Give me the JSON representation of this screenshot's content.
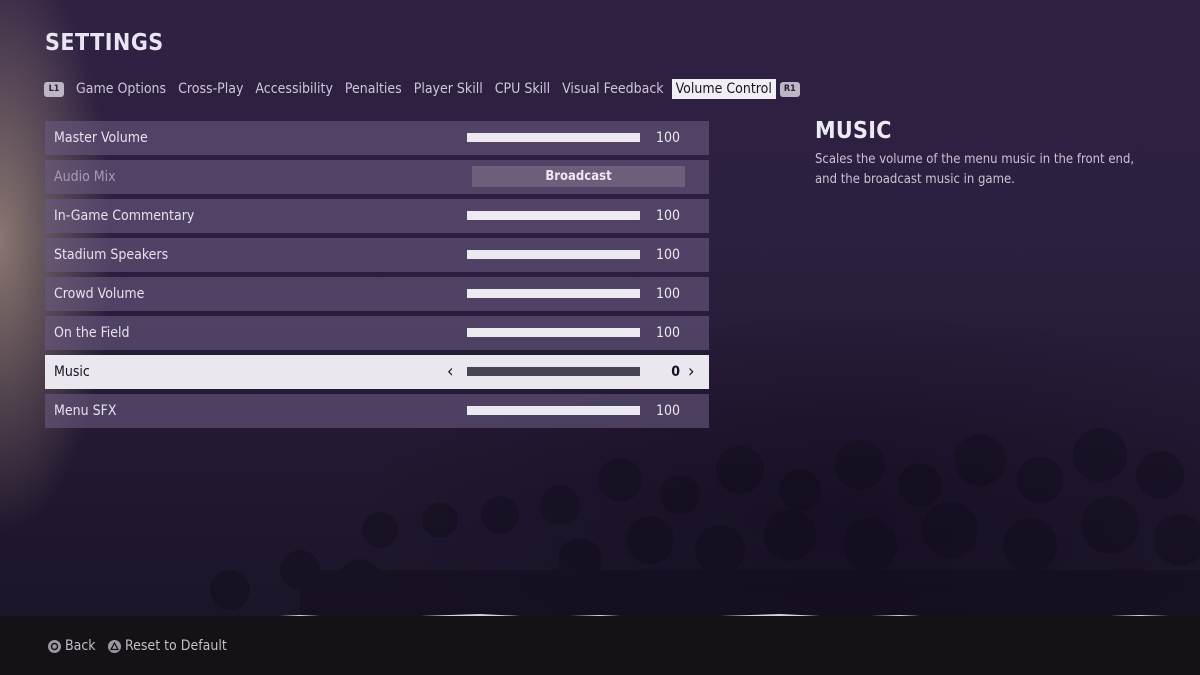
{
  "header": {
    "title": "SETTINGS"
  },
  "tabs": {
    "left_bumper": "L1",
    "right_bumper": "R1",
    "items": [
      {
        "label": "Game Options"
      },
      {
        "label": "Cross-Play"
      },
      {
        "label": "Accessibility"
      },
      {
        "label": "Penalties"
      },
      {
        "label": "Player Skill"
      },
      {
        "label": "CPU Skill"
      },
      {
        "label": "Visual Feedback"
      },
      {
        "label": "Volume Control",
        "active": true
      }
    ]
  },
  "settings": [
    {
      "label": "Master Volume",
      "type": "slider",
      "value": "100",
      "level": 1.0
    },
    {
      "label": "Audio Mix",
      "type": "select",
      "value": "Broadcast",
      "disabled": true
    },
    {
      "label": "In-Game Commentary",
      "type": "slider",
      "value": "100",
      "level": 1.0
    },
    {
      "label": "Stadium Speakers",
      "type": "slider",
      "value": "100",
      "level": 1.0
    },
    {
      "label": "Crowd Volume",
      "type": "slider",
      "value": "100",
      "level": 1.0
    },
    {
      "label": "On the Field",
      "type": "slider",
      "value": "100",
      "level": 1.0
    },
    {
      "label": "Music",
      "type": "slider",
      "value": "0",
      "level": 0.0,
      "selected": true
    },
    {
      "label": "Menu SFX",
      "type": "slider",
      "value": "100",
      "level": 1.0
    }
  ],
  "description": {
    "title": "MUSIC",
    "line1": "Scales the volume of the menu music in the front end,",
    "line2": "and the broadcast music in game."
  },
  "footer": {
    "back_label": "Back",
    "back_icon": "circle-button-icon",
    "reset_label": "Reset to Default",
    "reset_icon": "triangle-button-icon"
  },
  "colors": {
    "row_bg": "#68587e",
    "row_selected_bg": "#eae7ee",
    "active_tab_bg": "#f1eff4",
    "footer_bg": "#141215"
  }
}
